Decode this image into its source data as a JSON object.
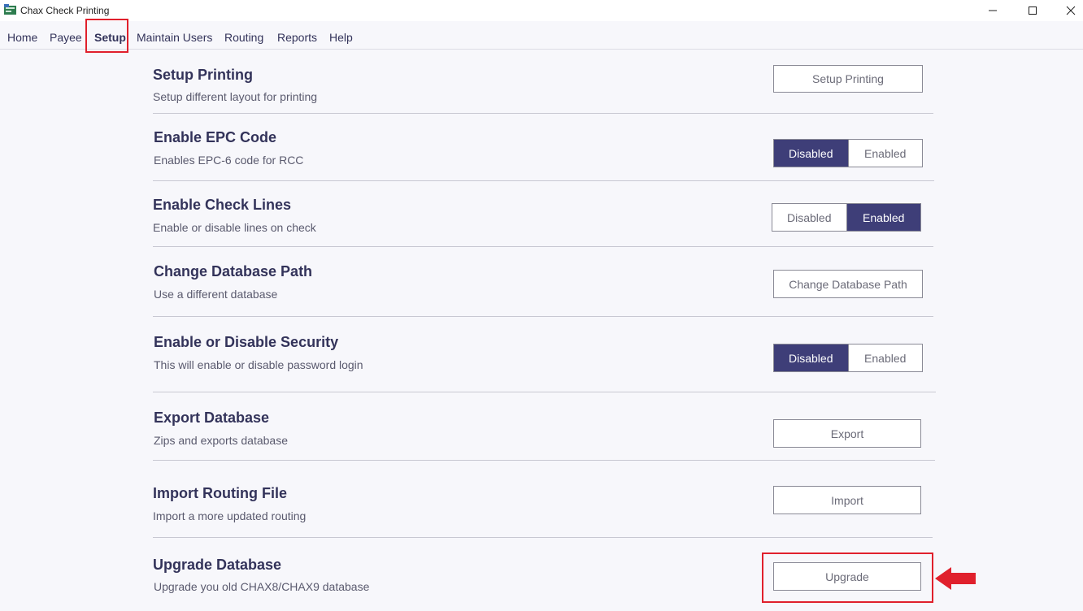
{
  "window": {
    "title": "Chax Check Printing"
  },
  "menu": {
    "items": [
      {
        "label": "Home"
      },
      {
        "label": "Payee"
      },
      {
        "label": "Setup"
      },
      {
        "label": "Maintain Users"
      },
      {
        "label": "Routing"
      },
      {
        "label": "Reports"
      },
      {
        "label": "Help"
      }
    ],
    "active": "Setup"
  },
  "settings": [
    {
      "title": "Setup Printing",
      "description": "Setup different layout for printing",
      "button": "Setup Printing"
    },
    {
      "title": "Enable EPC Code",
      "description": "Enables EPC-6 code for RCC",
      "options": [
        "Disabled",
        "Enabled"
      ],
      "selected": "Disabled"
    },
    {
      "title": "Enable Check Lines",
      "description": "Enable or disable lines on check",
      "options": [
        "Disabled",
        "Enabled"
      ],
      "selected": "Enabled"
    },
    {
      "title": "Change Database Path",
      "description": "Use a different database",
      "button": "Change Database Path"
    },
    {
      "title": "Enable or Disable Security",
      "description": "This will enable or disable password login",
      "options": [
        "Disabled",
        "Enabled"
      ],
      "selected": "Disabled"
    },
    {
      "title": "Export Database",
      "description": "Zips and exports database",
      "button": "Export"
    },
    {
      "title": "Import Routing File",
      "description": "Import a more updated routing",
      "button": "Import"
    },
    {
      "title": "Upgrade Database",
      "description": "Upgrade you old CHAX8/CHAX9 database",
      "button": "Upgrade"
    }
  ],
  "colors": {
    "accent": "#3e3e78",
    "highlight": "#e0202c",
    "background": "#f7f7fb"
  },
  "icons": {
    "app": "app-icon",
    "minimize": "minimize-icon",
    "maximize": "maximize-icon",
    "close": "close-icon",
    "annotation": "arrow-left-icon"
  }
}
